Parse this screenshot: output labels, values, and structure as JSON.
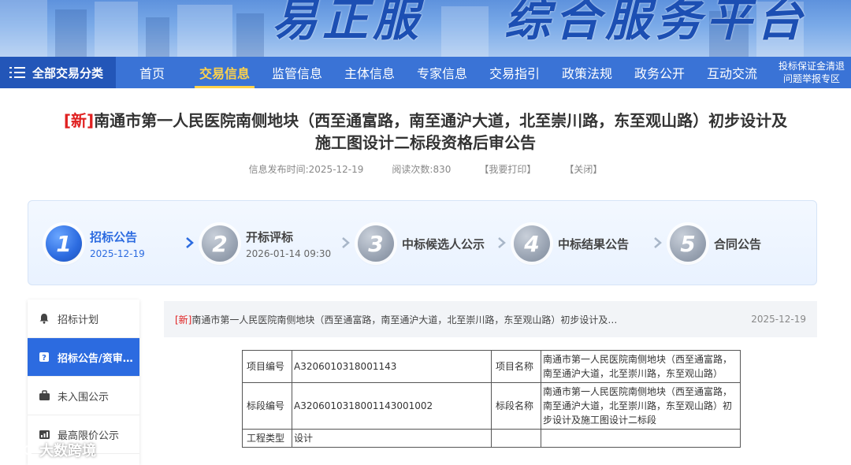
{
  "banner": {
    "text_left": "易正服",
    "text_right": "综合服务平台"
  },
  "nav": {
    "all_label": "全部交易分类",
    "items": [
      {
        "label": "首页"
      },
      {
        "label": "交易信息",
        "active": true
      },
      {
        "label": "监管信息"
      },
      {
        "label": "主体信息"
      },
      {
        "label": "专家信息"
      },
      {
        "label": "交易指引"
      },
      {
        "label": "政策法规"
      },
      {
        "label": "政务公开"
      },
      {
        "label": "互动交流"
      }
    ],
    "right_line1": "投标保证金清退",
    "right_line2": "问题举报专区"
  },
  "article": {
    "new_tag": "[新]",
    "title_line1": "南通市第一人民医院南侧地块（西至通富路，南至通沪大道，北至崇川路，东至观山路）初步设计及",
    "title_line2": "施工图设计二标段资格后审公告",
    "publish_time": "信息发布时间:2025-12-19",
    "read_count": "阅读次数:830",
    "print_label": "【我要打印】",
    "close_label": "【关闭】"
  },
  "steps": [
    {
      "num": "1",
      "name": "招标公告",
      "date": "2025-12-19",
      "active": true
    },
    {
      "num": "2",
      "name": "开标评标",
      "date": "2026-01-14 09:30",
      "active": false
    },
    {
      "num": "3",
      "name": "中标候选人公示",
      "date": "",
      "active": false
    },
    {
      "num": "4",
      "name": "中标结果公告",
      "date": "",
      "active": false
    },
    {
      "num": "5",
      "name": "合同公告",
      "date": "",
      "active": false
    }
  ],
  "sidebar": {
    "items": [
      {
        "label": "招标计划",
        "icon": "bell-icon"
      },
      {
        "label": "招标公告/资审…",
        "icon": "notice-icon",
        "active": true
      },
      {
        "label": "未入围公示",
        "icon": "briefcase-icon"
      },
      {
        "label": "最高限价公示",
        "icon": "chart-icon"
      }
    ]
  },
  "notice": {
    "new_tag": "[新]",
    "title": "南通市第一人民医院南侧地块（西至通富路，南至通沪大道，北至崇川路，东至观山路）初步设计及…",
    "date": "2025-12-19"
  },
  "table": {
    "rows": [
      {
        "l1": "项目编号",
        "v1": "A3206010318001143",
        "l2": "项目名称",
        "v2": "南通市第一人民医院南侧地块（西至通富路，南至通沪大道，北至崇川路，东至观山路）"
      },
      {
        "l1": "标段编号",
        "v1": "A3206010318001143001002",
        "l2": "标段名称",
        "v2": "南通市第一人民医院南侧地块（西至通富路，南至通沪大道，北至崇川路，东至观山路）初步设计及施工图设计二标段"
      },
      {
        "l1": "工程类型",
        "v1": "设计",
        "l2": "",
        "v2": ""
      }
    ]
  },
  "watermark": {
    "text": "大数跨境"
  }
}
